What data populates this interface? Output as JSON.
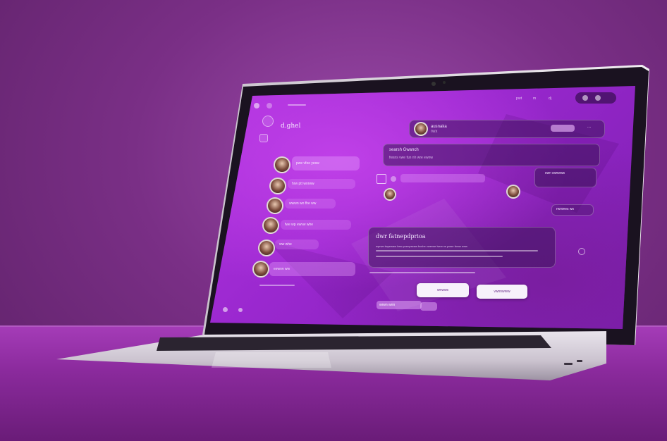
{
  "app": {
    "title": "d.ghel",
    "topbar": {
      "links": [
        "pwt",
        "m",
        "dj"
      ]
    }
  },
  "header": {
    "contact_name": "ausnaka",
    "contact_sub": "rwx",
    "action_label": "..."
  },
  "messages_left": [
    {
      "text": "pwe vfee yesw"
    },
    {
      "text": "hrw ptt wnrww"
    },
    {
      "text": "wwwn wo fhe ww"
    },
    {
      "text": "fwe wp ewvw whe"
    },
    {
      "text": "ww whe"
    },
    {
      "text": "eewrw ww"
    }
  ],
  "search_card": {
    "title": "searsh Gwanch",
    "subtitle": "fwsns vwe fun nh wre ewnw"
  },
  "compose_card": {
    "heading": "dwr fatnepdprioa",
    "body": "wprwe twpewaw bew pcenpseaw bcshe vwerwe twrw rw pwse fwnw wnw"
  },
  "right_cards": [
    {
      "text": "ewr cwnwws"
    },
    {
      "text": "rwrwres ws"
    }
  ],
  "buttons": {
    "primary": "wnwws",
    "secondary": "vwnnwrew"
  },
  "input": {
    "placeholder": "wrwn wnn"
  },
  "colors": {
    "screen_accent": "#b233e0",
    "background": "#7a2f86"
  }
}
